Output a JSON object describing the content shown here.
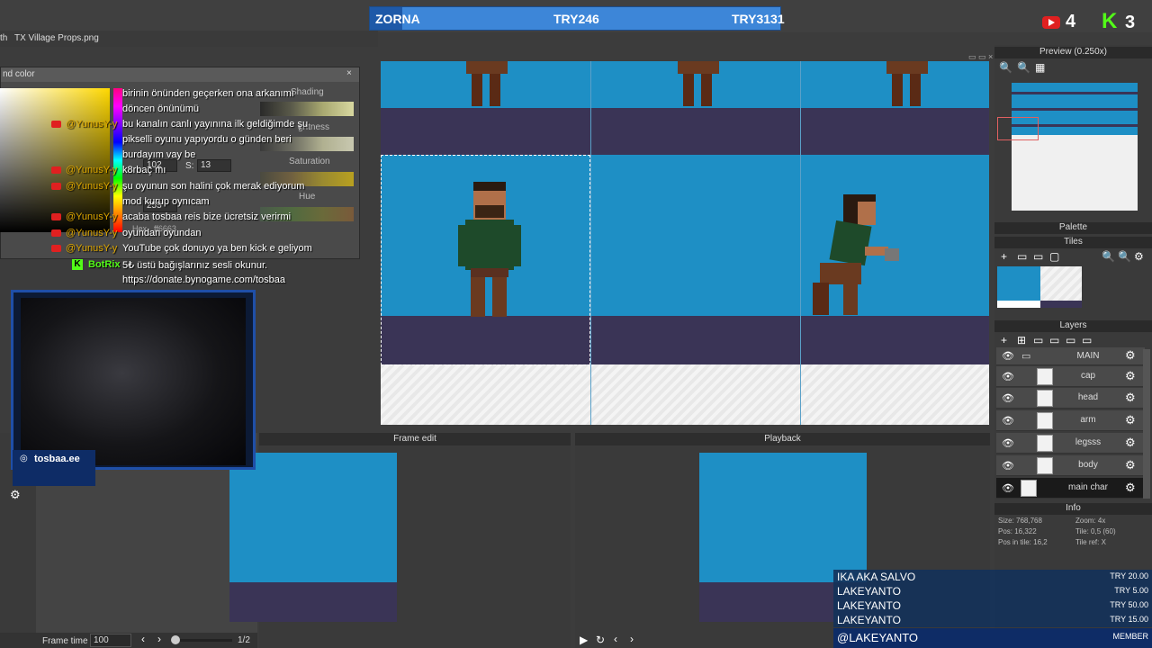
{
  "overlay": {
    "left_team": "ZORNA",
    "score_center": "TRY246",
    "score_right": "TRY3131",
    "youtube_count": "4",
    "kick_count": "3"
  },
  "file_tabs": [
    "th",
    "TX Village Props.png"
  ],
  "color_dialog": {
    "title": "nd color",
    "shading_label": "Shading",
    "brightness_label": "ghtness",
    "saturation_label": "Saturation",
    "hue_label": "Hue",
    "s_label": "S:",
    "s_value": "13",
    "g_value": "102",
    "b_value": "255",
    "hex_label": "Hex",
    "hex_value": "ff6663"
  },
  "chat": [
    {
      "name": "",
      "text": "birinin önünden geçerken ona arkanımı"
    },
    {
      "name": "",
      "text": "döncen önünümü"
    },
    {
      "name": "@YunusY-y",
      "text": "bu kanalın canlı yayınına ilk geldiğimde şu"
    },
    {
      "name": "",
      "text": "pikselli oyunu yapıyordu o günden beri"
    },
    {
      "name": "",
      "text": "burdayım vay be"
    },
    {
      "name": "@YunusY-y",
      "text": "k8rbaç mı"
    },
    {
      "name": "@YunusY-y",
      "text": "şu oyunun son halini çok merak ediyorum"
    },
    {
      "name": "",
      "text": "mod kurup oynıcam"
    },
    {
      "name": "@YunusY-y",
      "text": "acaba tosbaa reis bize ücretsiz verirmi"
    },
    {
      "name": "@YunusY-y",
      "text": "oyundan oyundan"
    },
    {
      "name": "@YunusY-y",
      "text": "YouTube çok donuyo ya ben kick e geliyom"
    },
    {
      "name": "BotRix",
      "text": "5₺ üstü bağışlarınız sesli okunur."
    },
    {
      "name": "",
      "text": "https://donate.bynogame.com/tosbaa"
    }
  ],
  "social": {
    "instagram": "tosbaa.ee"
  },
  "preview": {
    "title": "Preview (0.250x)"
  },
  "palette": {
    "title": "Palette"
  },
  "tiles": {
    "title": "Tiles"
  },
  "layers": {
    "title": "Layers",
    "items": [
      {
        "name": "MAIN",
        "type": "folder"
      },
      {
        "name": "cap"
      },
      {
        "name": "head"
      },
      {
        "name": "arm"
      },
      {
        "name": "legsss"
      },
      {
        "name": "body"
      },
      {
        "name": "main char",
        "selected": true
      }
    ]
  },
  "info": {
    "title": "Info",
    "size": "Size: 768,768",
    "zoom": "Zoom: 4x",
    "pos": "Pos: 16,322",
    "tile": "Tile: 0,5 (60)",
    "pos_in_tile": "Pos in tile: 16,2",
    "tile_ref": "Tile ref: X"
  },
  "frame_edit": {
    "title": "Frame edit",
    "frame_time_label": "Frame time",
    "frame_time_value": "100",
    "frame_counter": "1/2"
  },
  "playback": {
    "title": "Playback"
  },
  "donations": [
    {
      "name": "IKA AKA SALVO",
      "amount": "TRY 20.00"
    },
    {
      "name": "LAKEYANTO",
      "amount": "TRY 5.00"
    },
    {
      "name": "LAKEYANTO",
      "amount": "TRY 50.00"
    },
    {
      "name": "LAKEYANTO",
      "amount": "TRY 15.00"
    },
    {
      "name": "@LAKEYANTO",
      "amount": "MEMBER"
    }
  ],
  "colors": {
    "canvas_blue": "#1e8fc5",
    "ground_purple": "#3a3456",
    "accent_blue": "#3d86d8"
  }
}
